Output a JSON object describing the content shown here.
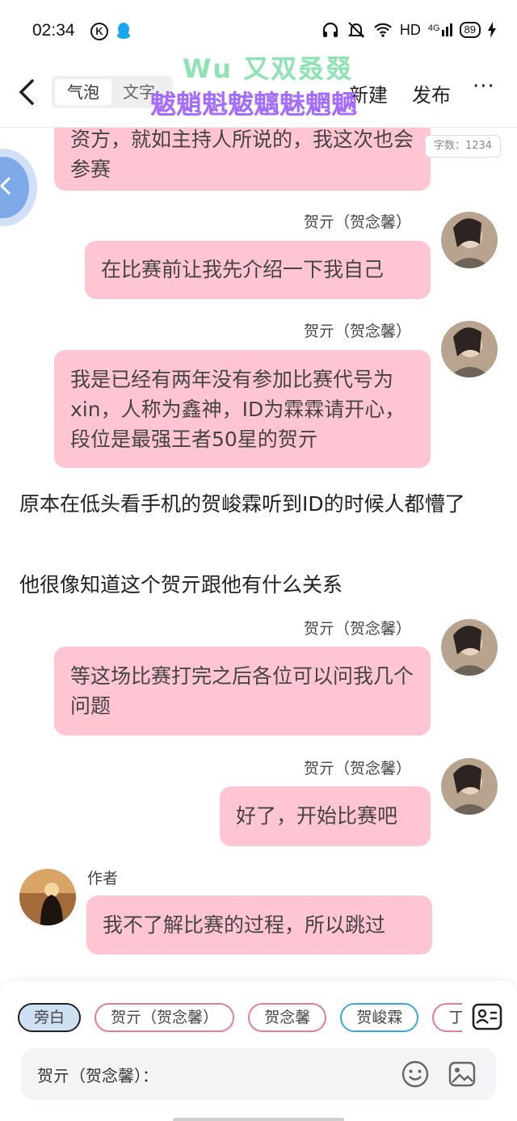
{
  "status_bar": {
    "time": "02:34",
    "network": "HD",
    "signal": "4G",
    "battery": "89"
  },
  "header": {
    "mode_tabs": [
      "气泡",
      "文字"
    ],
    "new_label": "新建",
    "publish_label": "发布",
    "more_label": "···",
    "watermark_line1": "Wu 又双叒叕",
    "watermark_line2": "魃魈魁魃魑魅魍魉"
  },
  "word_count": "字数：1234",
  "messages": [
    {
      "speaker": "",
      "text": "资方，就如主持人所说的，我这次也会参赛"
    },
    {
      "speaker": "贺亓（贺念馨）",
      "text": "在比赛前让我先介绍一下我自己"
    },
    {
      "speaker": "贺亓（贺念馨）",
      "text": "我是已经有两年没有参加比赛代号为xin，人称为鑫神，ID为霖霖请开心，段位是最强王者50星的贺亓"
    },
    {
      "narration": "原本在低头看手机的贺峻霖听到ID的时候人都懵了"
    },
    {
      "narration": "他很像知道这个贺亓跟他有什么关系"
    },
    {
      "speaker": "贺亓（贺念馨）",
      "text": "等这场比赛打完之后各位可以问我几个问题"
    },
    {
      "speaker": "贺亓（贺念馨）",
      "text": "好了，开始比赛吧"
    },
    {
      "speaker": "作者",
      "text": "我不了解比赛的过程，所以跳过"
    }
  ],
  "role_chips": [
    "旁白",
    "贺亓（贺念馨）",
    "贺念馨",
    "贺峻霖",
    "丁程"
  ],
  "input": {
    "prefix": "贺亓（贺念馨）："
  },
  "icons": {
    "back": "chevron-left-icon",
    "emoji": "smile-icon",
    "image": "image-icon",
    "roles": "contact-card-icon"
  },
  "colors": {
    "bubble": "#ffc5d2",
    "chip_pink": "#e77b98",
    "chip_blue": "#39a9d8",
    "watermark_green": "#8ee3b4",
    "watermark_purple": "#a46cff"
  }
}
